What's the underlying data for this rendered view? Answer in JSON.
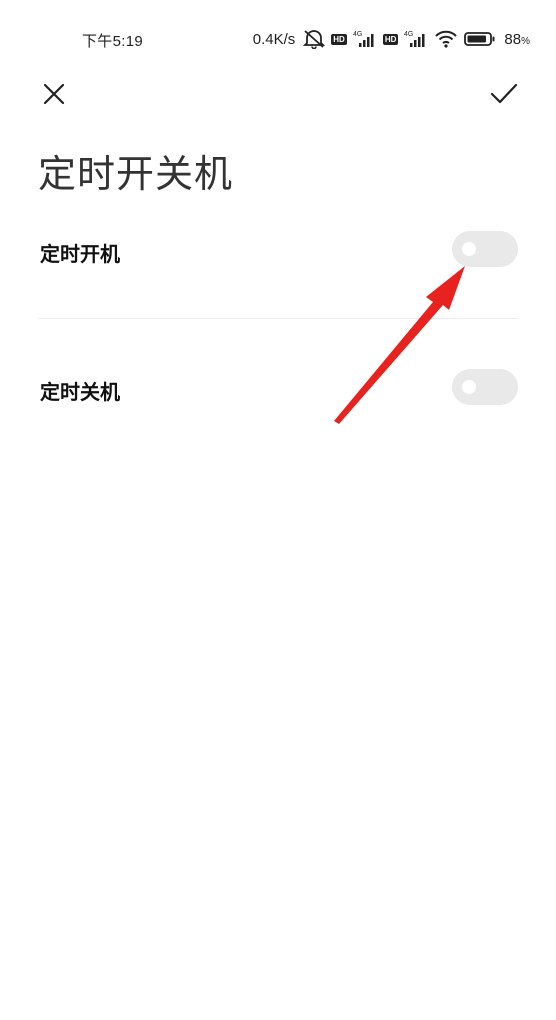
{
  "status_bar": {
    "time": "下午5:19",
    "net_speed": "0.4K/s",
    "network_type_1": "4G",
    "network_type_2": "4G",
    "hd_label": "HD",
    "battery_percent": "88",
    "battery_percent_sign": "%",
    "battery_level": 0.88,
    "icons": [
      "alarm-off-icon",
      "hd-icon",
      "signal-icon",
      "hd-icon",
      "signal-icon",
      "wifi-icon",
      "battery-icon"
    ]
  },
  "toolbar": {
    "close_icon": "close-icon",
    "confirm_icon": "check-icon"
  },
  "page": {
    "title": "定时开关机"
  },
  "settings": [
    {
      "label": "定时开机",
      "enabled": false
    },
    {
      "label": "定时关机",
      "enabled": false
    }
  ],
  "annotation": {
    "type": "red-arrow",
    "color": "#e8231f",
    "points_to": "定时开机 toggle"
  }
}
